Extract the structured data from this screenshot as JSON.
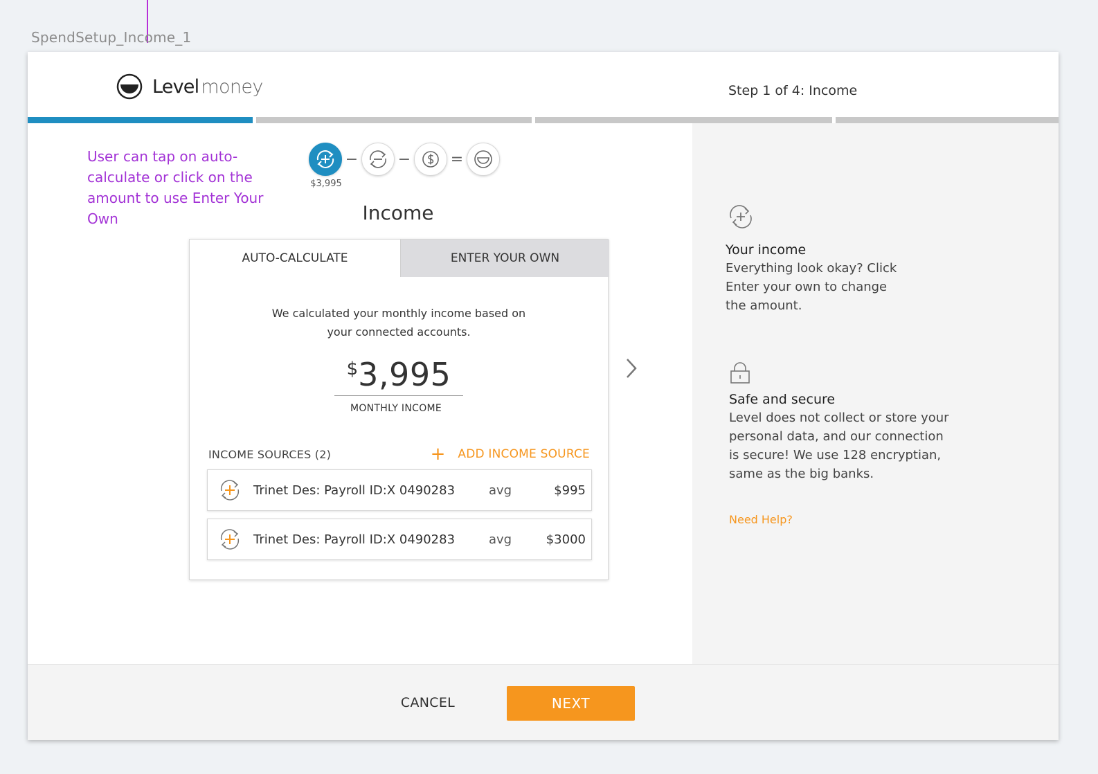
{
  "artboard": {
    "label": "SpendSetup_Income_1"
  },
  "header": {
    "logo_level": "Level",
    "logo_money": "money",
    "step_label": "Step 1 of 4: Income"
  },
  "annotation": {
    "text": "User can tap on auto-calculate or click on the amount to use Enter Your Own"
  },
  "equation": {
    "income_amount": "$3,995",
    "op_minus_1": "−",
    "op_minus_2": "−",
    "op_equals": "="
  },
  "main": {
    "title": "Income",
    "tabs": [
      {
        "label": "AUTO-CALCULATE",
        "active": true
      },
      {
        "label": "ENTER YOUR OWN",
        "active": false
      }
    ],
    "description": "We calculated your monthly income based on your connected accounts.",
    "amount_currency": "$",
    "amount_value": "3,995",
    "amount_label": "MONTHLY INCOME",
    "sources_heading": "INCOME SOURCES (2)",
    "add_source_plus": "+",
    "add_source_label": "ADD INCOME SOURCE",
    "sources": [
      {
        "name": "Trinet Des: Payroll ID:X 0490283",
        "avg_label": "avg",
        "amount": "$995"
      },
      {
        "name": "Trinet Des: Payroll ID:X 0490283",
        "avg_label": "avg",
        "amount": "$3000"
      }
    ]
  },
  "sidebar": {
    "income_title": "Your income",
    "income_body": "Everything look okay? Click Enter your own to change the amount.",
    "secure_title": "Safe and secure",
    "secure_body": "Level does not collect or store your personal data, and our connection is secure! We use 128 encryptian, same as the big banks.",
    "help_link": "Need Help?"
  },
  "footer": {
    "cancel_label": "CANCEL",
    "next_label": "NEXT"
  },
  "colors": {
    "accent_blue": "#1f8ec1",
    "accent_orange": "#f6961e",
    "annotation_purple": "#a333d6"
  },
  "progress": {
    "current_step": 1,
    "total_steps": 4
  }
}
